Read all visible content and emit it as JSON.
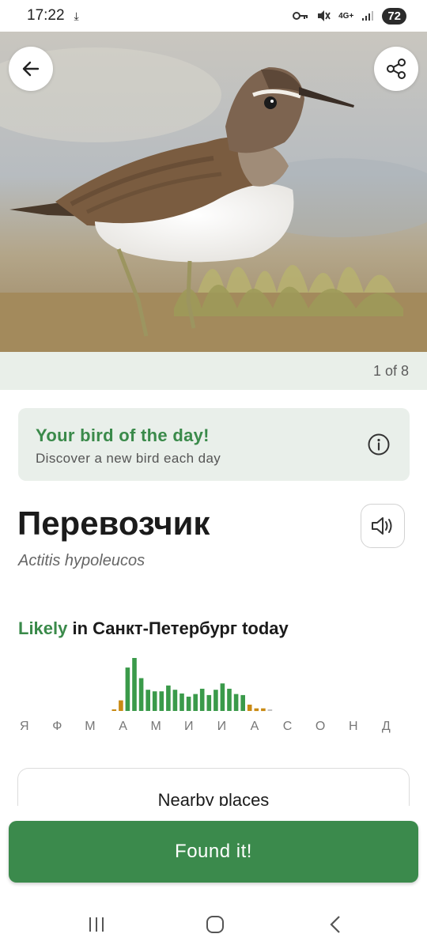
{
  "status_bar": {
    "time": "17:22",
    "network": "4G+",
    "battery": "72"
  },
  "hero": {
    "pager": "1 of 8"
  },
  "bird_of_day": {
    "title": "Your bird of the day!",
    "subtitle": "Discover a new bird each day"
  },
  "bird": {
    "name": "Перевозчик",
    "latin": "Actitis hypoleucos"
  },
  "likelihood": {
    "word": "Likely",
    "rest": " in Санкт-Петербург today"
  },
  "chart_data": {
    "type": "bar",
    "months": [
      "Я",
      "Ф",
      "М",
      "А",
      "М",
      "И",
      "И",
      "А",
      "С",
      "О",
      "Н",
      "Д"
    ],
    "values": [
      0,
      0,
      0,
      0,
      0.02,
      0.2,
      0.82,
      1.0,
      0.62,
      0.4,
      0.37,
      0.37,
      0.48,
      0.4,
      0.33,
      0.27,
      0.32,
      0.42,
      0.3,
      0.4,
      0.52,
      0.42,
      0.32,
      0.3,
      0.12,
      0.05,
      0.05,
      0,
      0,
      0,
      0,
      0,
      0,
      0,
      0,
      0,
      0,
      0,
      0,
      0,
      0,
      0,
      0,
      0,
      0,
      0,
      0,
      0
    ],
    "colors": [
      "#c3c3c3",
      "#c3c3c3",
      "#c3c3c3",
      "#c3c3c3",
      "#c98a14",
      "#c98a14",
      "#3a9a4a",
      "#3a9a4a",
      "#3a9a4a",
      "#3a9a4a",
      "#3a9a4a",
      "#3a9a4a",
      "#3a9a4a",
      "#3a9a4a",
      "#3a9a4a",
      "#3a9a4a",
      "#3a9a4a",
      "#3a9a4a",
      "#3a9a4a",
      "#3a9a4a",
      "#3a9a4a",
      "#3a9a4a",
      "#3a9a4a",
      "#3a9a4a",
      "#c98a14",
      "#c98a14",
      "#c98a14",
      "#c3c3c3",
      "#c3c3c3",
      "#c3c3c3",
      "#c3c3c3",
      "#c3c3c3",
      "#c3c3c3",
      "#c3c3c3",
      "#c3c3c3",
      "#c3c3c3",
      "#c3c3c3",
      "#c3c3c3",
      "#c3c3c3",
      "#c3c3c3",
      "#c3c3c3",
      "#c3c3c3",
      "#c3c3c3",
      "#c3c3c3",
      "#c3c3c3",
      "#c3c3c3",
      "#c3c3c3",
      "#c3c3c3"
    ]
  },
  "nearby": {
    "label": "Nearby places"
  },
  "found_button": {
    "label": "Found it!"
  },
  "colors": {
    "accent_green": "#3b8a4c",
    "rare_orange": "#c98a14",
    "card_bg": "#e9efea"
  },
  "icons": {
    "back": "arrow-left-icon",
    "share": "share-icon",
    "info": "info-icon",
    "sound": "speaker-icon"
  }
}
